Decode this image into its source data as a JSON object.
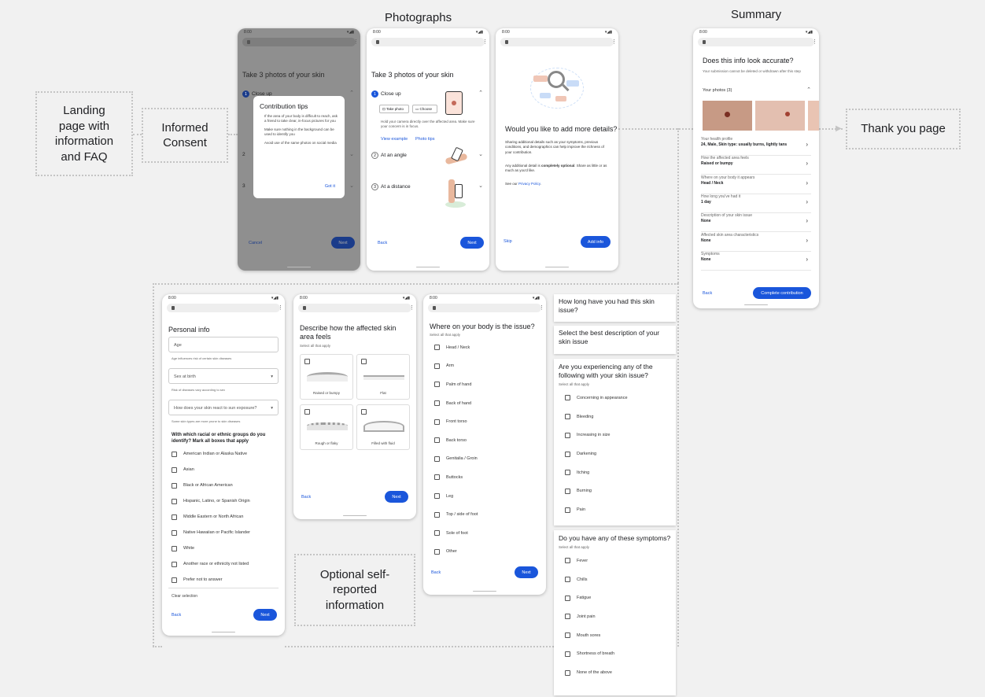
{
  "labels": {
    "photographs": "Photographs",
    "summary": "Summary",
    "landing": "Landing page with information and FAQ",
    "consent": "Informed Consent",
    "thank_you": "Thank you page",
    "optional": "Optional self-reported information"
  },
  "status_time": "8:00",
  "screen_tips": {
    "title": "Take 3 photos of your skin",
    "step1": "Close up",
    "step2_num": "2",
    "step3_num": "3",
    "dialog_title": "Contribution tips",
    "tip1": "If the area of your body is difficult to reach, ask a friend to take clear, in-focus pictures for you",
    "tip2": "Make sure nothing in the background can be used to identify you",
    "tip3": "Avoid use of the same photos on social media",
    "got_it": "Got it",
    "cancel": "Cancel",
    "next": "Next"
  },
  "screen_photos": {
    "title": "Take 3 photos of your skin",
    "step1": "Close up",
    "take_photo": "Take photo",
    "choose": "Choose",
    "instructions": "Hold your camera directly over the affected area. Make sure your concern is in focus.",
    "view_example": "View example",
    "photo_tips": "Photo tips",
    "step2": "At an angle",
    "step3": "At a distance",
    "back": "Back",
    "next": "Next"
  },
  "screen_details": {
    "title": "Would you like to add more details?",
    "p1": "Sharing additional details such as your symptoms, previous conditions, and demographics can help improve the richness of your contribution.",
    "p2a": "Any additional detail is ",
    "p2b": "completely optional",
    "p2c": ". Share as little or as much as you'd like.",
    "p3a": "See our ",
    "p3b": "Privacy Policy",
    "p3c": ".",
    "skip": "Skip",
    "add_info": "Add info"
  },
  "screen_summary": {
    "title": "Does this info look accurate?",
    "subtitle": "Your submission cannot be deleted or withdrawn after this step",
    "your_photos": "Your photos (3)",
    "rows": [
      {
        "t": "Your health profile",
        "v": "24, Male, Skin type: usually burns, lightly tans"
      },
      {
        "t": "How the affected area feels",
        "v": "Raised or bumpy"
      },
      {
        "t": "Where on your body it appears",
        "v": "Head / Neck"
      },
      {
        "t": "How long you've had it",
        "v": "1 day"
      },
      {
        "t": "Description of your skin issue",
        "v": "None"
      },
      {
        "t": "Affected skin area characteristics",
        "v": "None"
      },
      {
        "t": "Symptoms",
        "v": "None"
      }
    ],
    "back": "Back",
    "complete": "Complete contribution"
  },
  "screen_personal": {
    "title": "Personal info",
    "age": "Age",
    "age_hint": "Age influences risk of certain skin diseases",
    "sex": "Sex at birth",
    "sex_hint": "Risk of diseases vary according to sex",
    "sun": "How does your skin react to sun exposure?",
    "sun_hint": "Some skin types are more prone to skin diseases",
    "ethnic_q": "With which racial or ethnic groups do you identify? Mark all boxes that apply",
    "options": [
      "American Indian or Alaska Native",
      "Asian",
      "Black or African American",
      "Hispanic, Latino, or Spanish Origin",
      "Middle Eastern or North African",
      "Native Hawaiian or Pacific Islander",
      "White",
      "Another race or ethnicity not listed",
      "Prefer not to answer"
    ],
    "clear": "Clear selection",
    "back": "Back",
    "next": "Next"
  },
  "screen_feel": {
    "title": "Describe how the affected skin area feels",
    "sub": "Select all that apply",
    "opts": [
      "Raised or bumpy",
      "Flat",
      "Rough or flaky",
      "Filled with fluid"
    ],
    "back": "Back",
    "next": "Next"
  },
  "screen_where": {
    "title": "Where on your body is the issue?",
    "sub": "Select all that apply",
    "opts": [
      "Head / Neck",
      "Arm",
      "Palm of hand",
      "Back of hand",
      "Front torso",
      "Back torso",
      "Genitalia / Groin",
      "Buttocks",
      "Leg",
      "Top / side of foot",
      "Sole of foot",
      "Other"
    ],
    "back": "Back",
    "next": "Next"
  },
  "cards": {
    "how_long": "How long have you had this skin issue?",
    "description": "Select the best description of your skin issue",
    "experiencing": "Are you experiencing any of the following with your skin issue?",
    "experiencing_sub": "Select all that apply",
    "experiencing_opts": [
      "Concerning in appearance",
      "Bleeding",
      "Increasing in size",
      "Darkening",
      "Itching",
      "Burning",
      "Pain"
    ],
    "symptoms": "Do you have any of these symptoms?",
    "symptoms_sub": "Select all that apply",
    "symptoms_opts": [
      "Fever",
      "Chills",
      "Fatigue",
      "Joint pain",
      "Mouth sores",
      "Shortness of breath",
      "None of the above"
    ]
  }
}
